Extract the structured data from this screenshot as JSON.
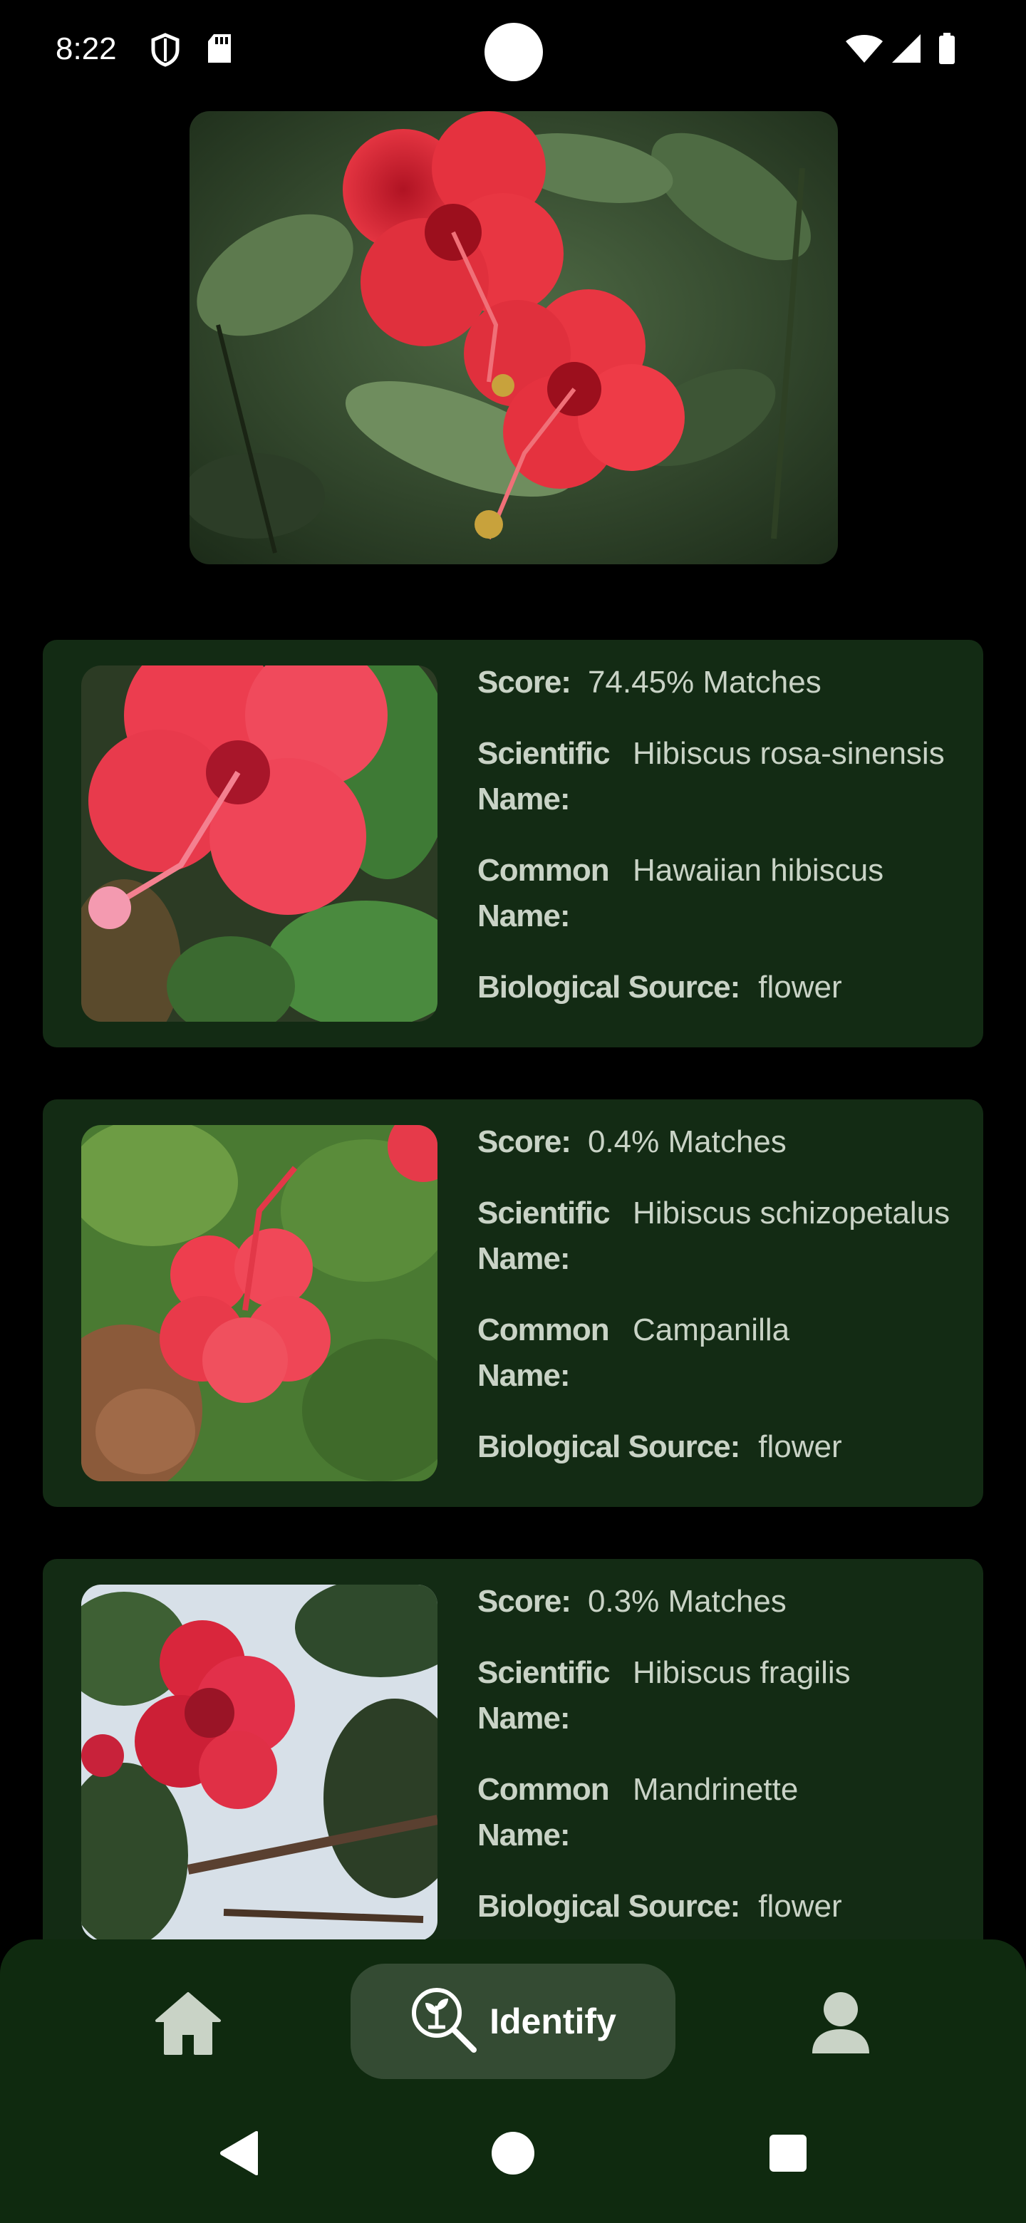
{
  "status_bar": {
    "time": "8:22",
    "icons": [
      "shield-icon",
      "sd-card-icon",
      "wifi-icon",
      "signal-icon",
      "battery-icon"
    ]
  },
  "hero_image": {
    "subject": "red hibiscus flower photo"
  },
  "results": [
    {
      "score_label": "Score:",
      "score_value": "74.45% Matches",
      "scientific_label": "Scientific Name:",
      "scientific_value": "Hibiscus rosa-sinensis",
      "common_label": "Common Name:",
      "common_value": "Hawaiian hibiscus",
      "source_label": "Biological Source:",
      "source_value": "flower"
    },
    {
      "score_label": "Score:",
      "score_value": "0.4% Matches",
      "scientific_label": "Scientific Name:",
      "scientific_value": "Hibiscus schizopetalus",
      "common_label": "Common Name:",
      "common_value": "Campanilla",
      "source_label": "Biological Source:",
      "source_value": "flower"
    },
    {
      "score_label": "Score:",
      "score_value": "0.3% Matches",
      "scientific_label": "Scientific Name:",
      "scientific_value": "Hibiscus fragilis",
      "common_label": "Common Name:",
      "common_value": "Mandrinette",
      "source_label": "Biological Source:",
      "source_value": "flower"
    }
  ],
  "bottom_nav": {
    "items": [
      {
        "icon": "home-icon",
        "label": ""
      },
      {
        "icon": "plant-search-icon",
        "label": "Identify"
      },
      {
        "icon": "profile-icon",
        "label": ""
      }
    ]
  },
  "colors": {
    "background": "#000000",
    "card": "#132b14",
    "nav": "#0f2a0f",
    "nav_active": "#344b33",
    "text": "#c9d3c6"
  }
}
